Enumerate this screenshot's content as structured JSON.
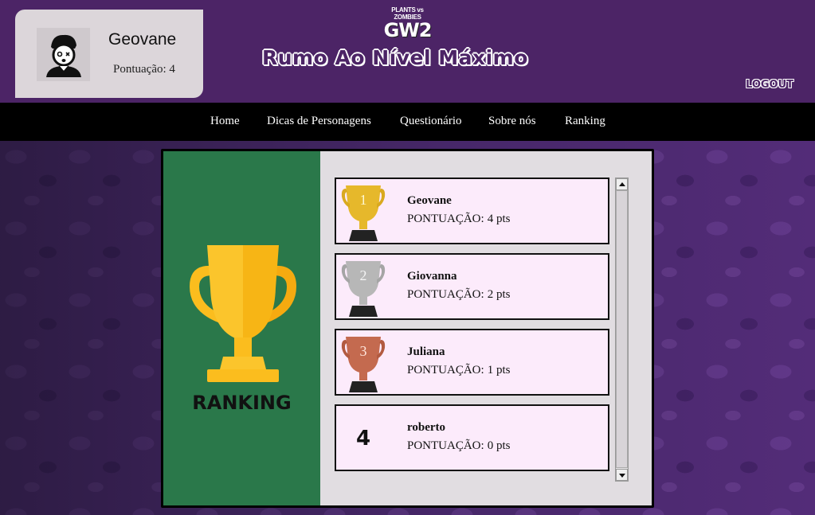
{
  "header": {
    "profile": {
      "username": "Geovane",
      "score_text": "Pontuação: 4"
    },
    "logo": {
      "top_text": "PLANTS vs ZOMBIES",
      "main_text": "GW2"
    },
    "site_title": "Rumo Ao Nível Máximo",
    "logout_label": "LOGOUT"
  },
  "nav": {
    "items": [
      {
        "label": "Home"
      },
      {
        "label": "Dicas de Personagens"
      },
      {
        "label": "Questionário"
      },
      {
        "label": "Sobre nós"
      },
      {
        "label": "Ranking"
      }
    ]
  },
  "ranking": {
    "heading": "RANKING",
    "score_prefix": "PONTUAÇÃO:",
    "entries": [
      {
        "rank": "1",
        "name": "Geovane",
        "score": "4 pts",
        "trophy": "gold-trophy-icon",
        "color": "#e6b82b"
      },
      {
        "rank": "2",
        "name": "Giovanna",
        "score": "2 pts",
        "trophy": "silver-trophy-icon",
        "color": "#b7b7b7"
      },
      {
        "rank": "3",
        "name": "Juliana",
        "score": "1 pts",
        "trophy": "bronze-trophy-icon",
        "color": "#c46a4f"
      },
      {
        "rank": "4",
        "name": "roberto",
        "score": "0 pts",
        "trophy": null
      }
    ]
  },
  "colors": {
    "header_bg": "#4c2466",
    "nav_bg": "#000000",
    "panel_left_bg": "#2a784a",
    "entry_bg": "#fcebfb",
    "trophy_gold": "#fbbd1e"
  }
}
